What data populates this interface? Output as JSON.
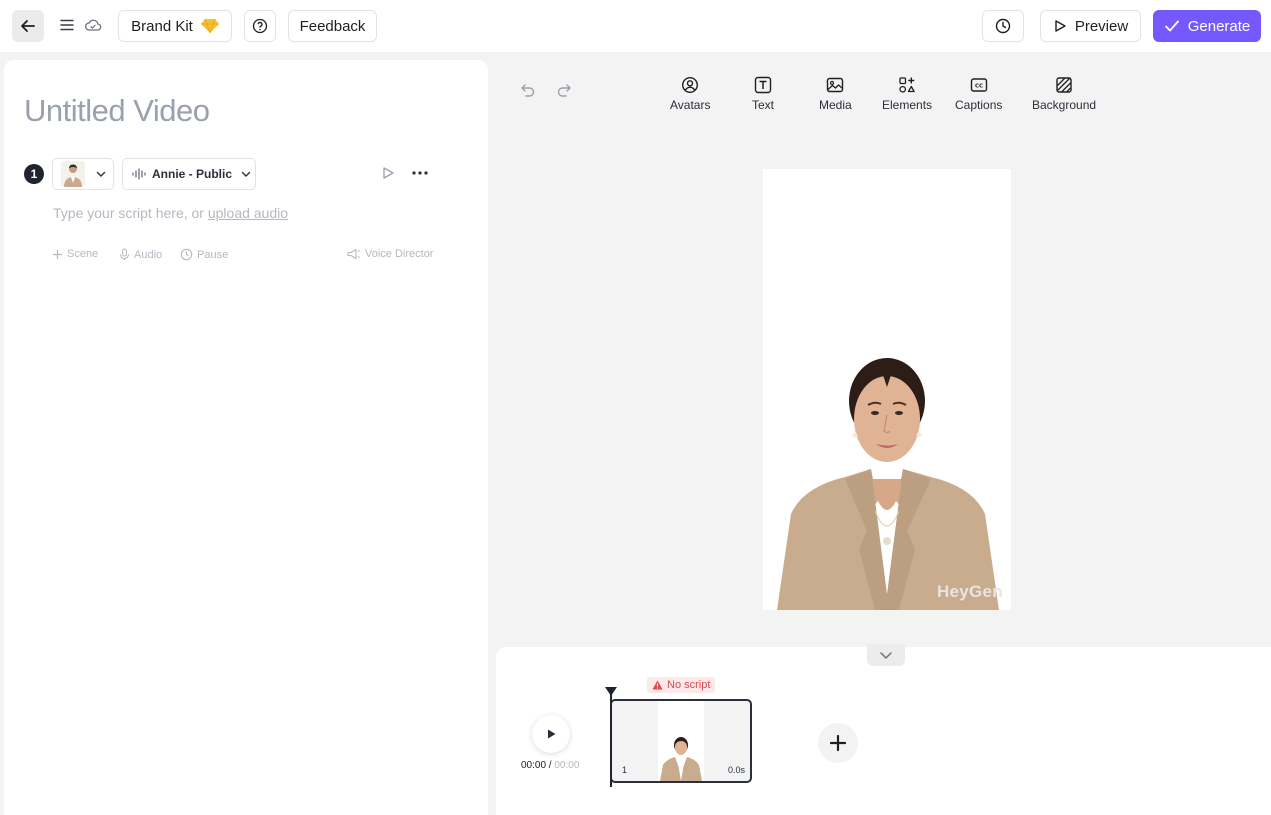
{
  "topbar": {
    "brand_kit_label": "Brand Kit",
    "feedback_label": "Feedback",
    "preview_label": "Preview",
    "generate_label": "Generate",
    "accent_color": "#7559ff"
  },
  "editor": {
    "title": "Untitled Video",
    "scene_number": "1",
    "voice_label": "Annie - Public",
    "script_placeholder": "Type your script here, or",
    "upload_link": "upload audio",
    "tools": {
      "scene": "Scene",
      "audio": "Audio",
      "pause": "Pause",
      "voice_director": "Voice Director"
    }
  },
  "toolbar": {
    "avatars": "Avatars",
    "text": "Text",
    "media": "Media",
    "elements": "Elements",
    "captions": "Captions",
    "background": "Background"
  },
  "canvas": {
    "watermark": "HeyGen"
  },
  "timeline": {
    "current_time": "00:00",
    "total_time": "00:00",
    "warning": "No script",
    "scene_index": "1",
    "scene_duration": "0.0s"
  }
}
